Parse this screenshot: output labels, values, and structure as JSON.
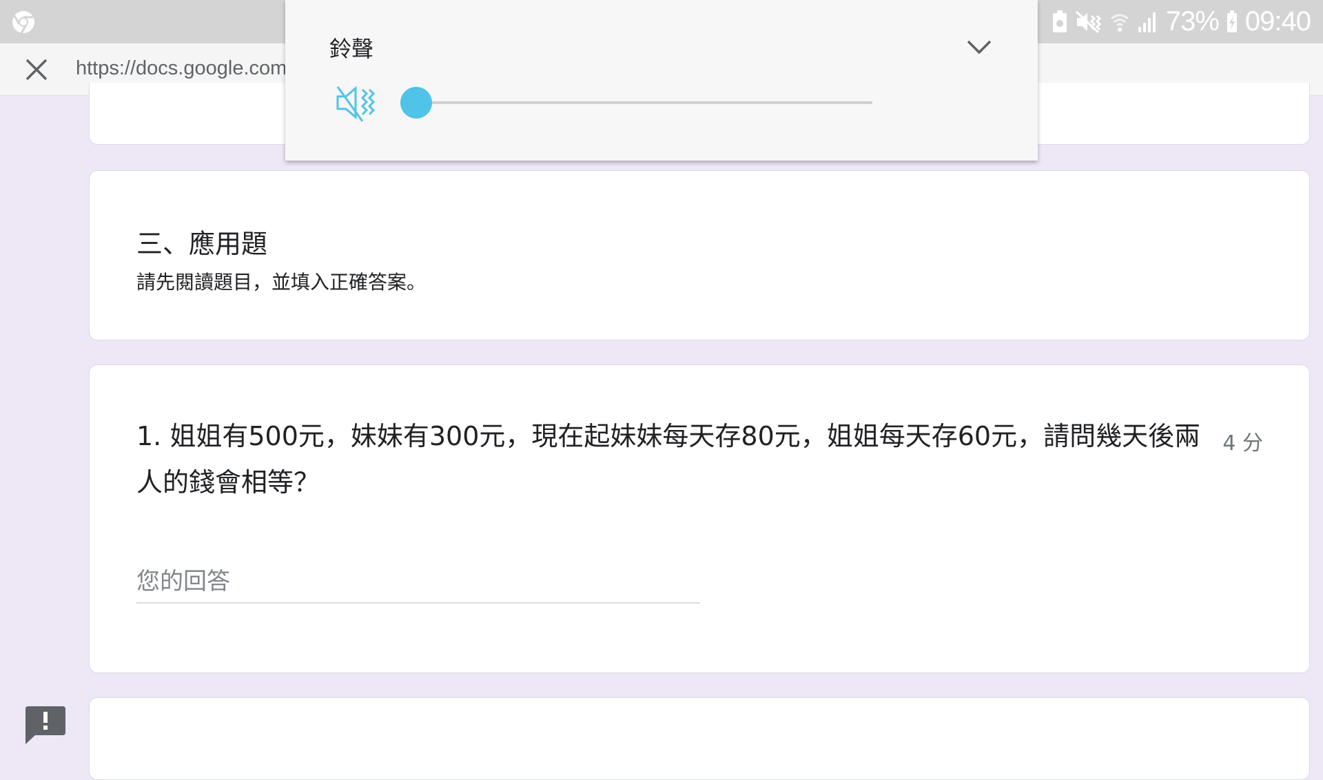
{
  "status_bar": {
    "battery_percent": "73%",
    "time": "09:40",
    "icons": [
      "chrome-icon",
      "battery-saver-icon",
      "mute-vibrate-icon",
      "wifi-icon",
      "signal-icon",
      "charging-icon"
    ]
  },
  "browser": {
    "url": "https://docs.google.com"
  },
  "volume_panel": {
    "label": "鈴聲",
    "level": 0,
    "accent_color": "#4fc3e8",
    "icons": [
      "volume-mute-icon",
      "chevron-down-icon"
    ]
  },
  "form": {
    "section": {
      "title": "三、應用題",
      "description": "請先閱讀題目，並填入正確答案。"
    },
    "question": {
      "text": "1. 姐姐有500元，妹妹有300元，現在起妹妹每天存80元，姐姐每天存60元，請問幾天後兩人的錢會相等？",
      "points": "4 分",
      "answer_placeholder": "您的回答",
      "answer_value": ""
    },
    "background_color": "#ede7f6"
  }
}
